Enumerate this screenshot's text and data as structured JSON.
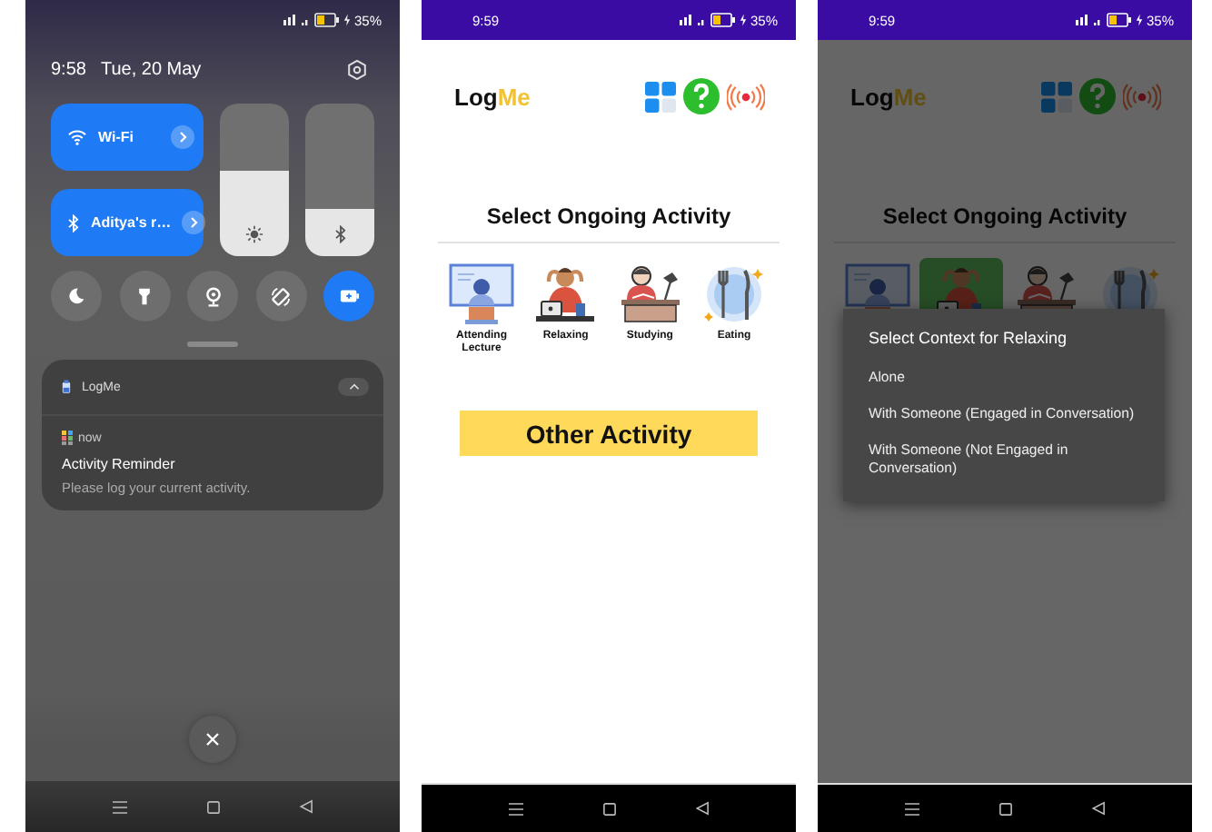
{
  "notification_shade": {
    "status_bar": {
      "battery": "35%"
    },
    "time": "9:58",
    "date": "Tue, 20 May",
    "tiles": [
      {
        "kind": "wifi",
        "label": "Wi-Fi",
        "on": true
      },
      {
        "kind": "bluetooth",
        "label": "Aditya's r…",
        "on": true
      }
    ],
    "sliders": [
      {
        "kind": "brightness",
        "level": 0.56
      },
      {
        "kind": "bluetooth",
        "level": 0.31
      }
    ],
    "toggles": [
      {
        "kind": "moon",
        "on": false
      },
      {
        "kind": "flashlight",
        "on": false
      },
      {
        "kind": "location",
        "on": false
      },
      {
        "kind": "rotate",
        "on": false
      },
      {
        "kind": "battery",
        "on": true
      }
    ],
    "notification": {
      "app": "LogMe",
      "expanded": true,
      "time": "now",
      "title": "Activity Reminder",
      "text": "Please log your current activity."
    }
  },
  "activity_screen": {
    "status_bar": {
      "time": "9:59",
      "battery": "35%"
    },
    "logo": [
      "Log",
      "Me"
    ],
    "title": "Select Ongoing Activity",
    "activities": [
      {
        "kind": "lecture",
        "label": "Attending Lecture",
        "selected": false
      },
      {
        "kind": "relaxing",
        "label": "Relaxing",
        "selected": false
      },
      {
        "kind": "studying",
        "label": "Studying",
        "selected": false
      },
      {
        "kind": "eating",
        "label": "Eating",
        "selected": false
      }
    ],
    "button": "Other Activity"
  },
  "activity_screen_dialog": {
    "status_bar": {
      "time": "9:59",
      "battery": "35%"
    },
    "logo": [
      "Log",
      "Me"
    ],
    "title": "Select Ongoing Activity",
    "activities": [
      {
        "kind": "lecture",
        "selected": false
      },
      {
        "kind": "relaxing",
        "selected": true
      },
      {
        "kind": "studying",
        "selected": false
      },
      {
        "kind": "eating",
        "selected": false
      }
    ],
    "dialog": {
      "title": "Select Context for Relaxing",
      "options": [
        "Alone",
        "With Someone (Engaged in Conversation)",
        "With Someone (Not Engaged in Conversation)"
      ]
    }
  }
}
